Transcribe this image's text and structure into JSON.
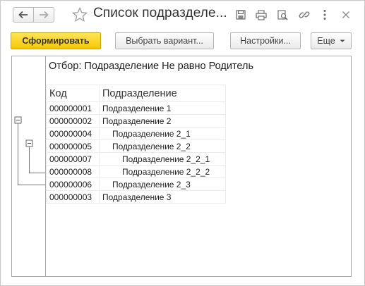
{
  "window": {
    "title": "Список подразделе...",
    "accent": "#f6c700"
  },
  "toolbar": {
    "generate_label": "Сформировать",
    "choose_variant_label": "Выбрать вариант...",
    "settings_label": "Настройки...",
    "more_label": "Еще"
  },
  "report": {
    "filter_text": "Отбор: Подразделение Не равно Родитель",
    "columns": {
      "code": "Код",
      "name": "Подразделение"
    },
    "rows": [
      {
        "code": "000000001",
        "name": "Подразделение 1",
        "level": 1
      },
      {
        "code": "000000002",
        "name": "Подразделение 2",
        "level": 1
      },
      {
        "code": "000000004",
        "name": "Подразделение 2_1",
        "level": 2
      },
      {
        "code": "000000005",
        "name": "Подразделение 2_2",
        "level": 2
      },
      {
        "code": "000000007",
        "name": "Подразделение 2_2_1",
        "level": 3
      },
      {
        "code": "000000008",
        "name": "Подразделение 2_2_2",
        "level": 3
      },
      {
        "code": "000000006",
        "name": "Подразделение 2_3",
        "level": 2
      },
      {
        "code": "000000003",
        "name": "Подразделение 3",
        "level": 1
      }
    ]
  },
  "icons": {
    "back": "arrow-left-icon",
    "forward": "arrow-right-icon",
    "favorite": "star-icon",
    "save": "floppy-disk-icon",
    "print": "printer-icon",
    "preview": "print-preview-icon",
    "link": "link-icon",
    "more": "kebab-menu-icon",
    "close": "close-icon"
  }
}
